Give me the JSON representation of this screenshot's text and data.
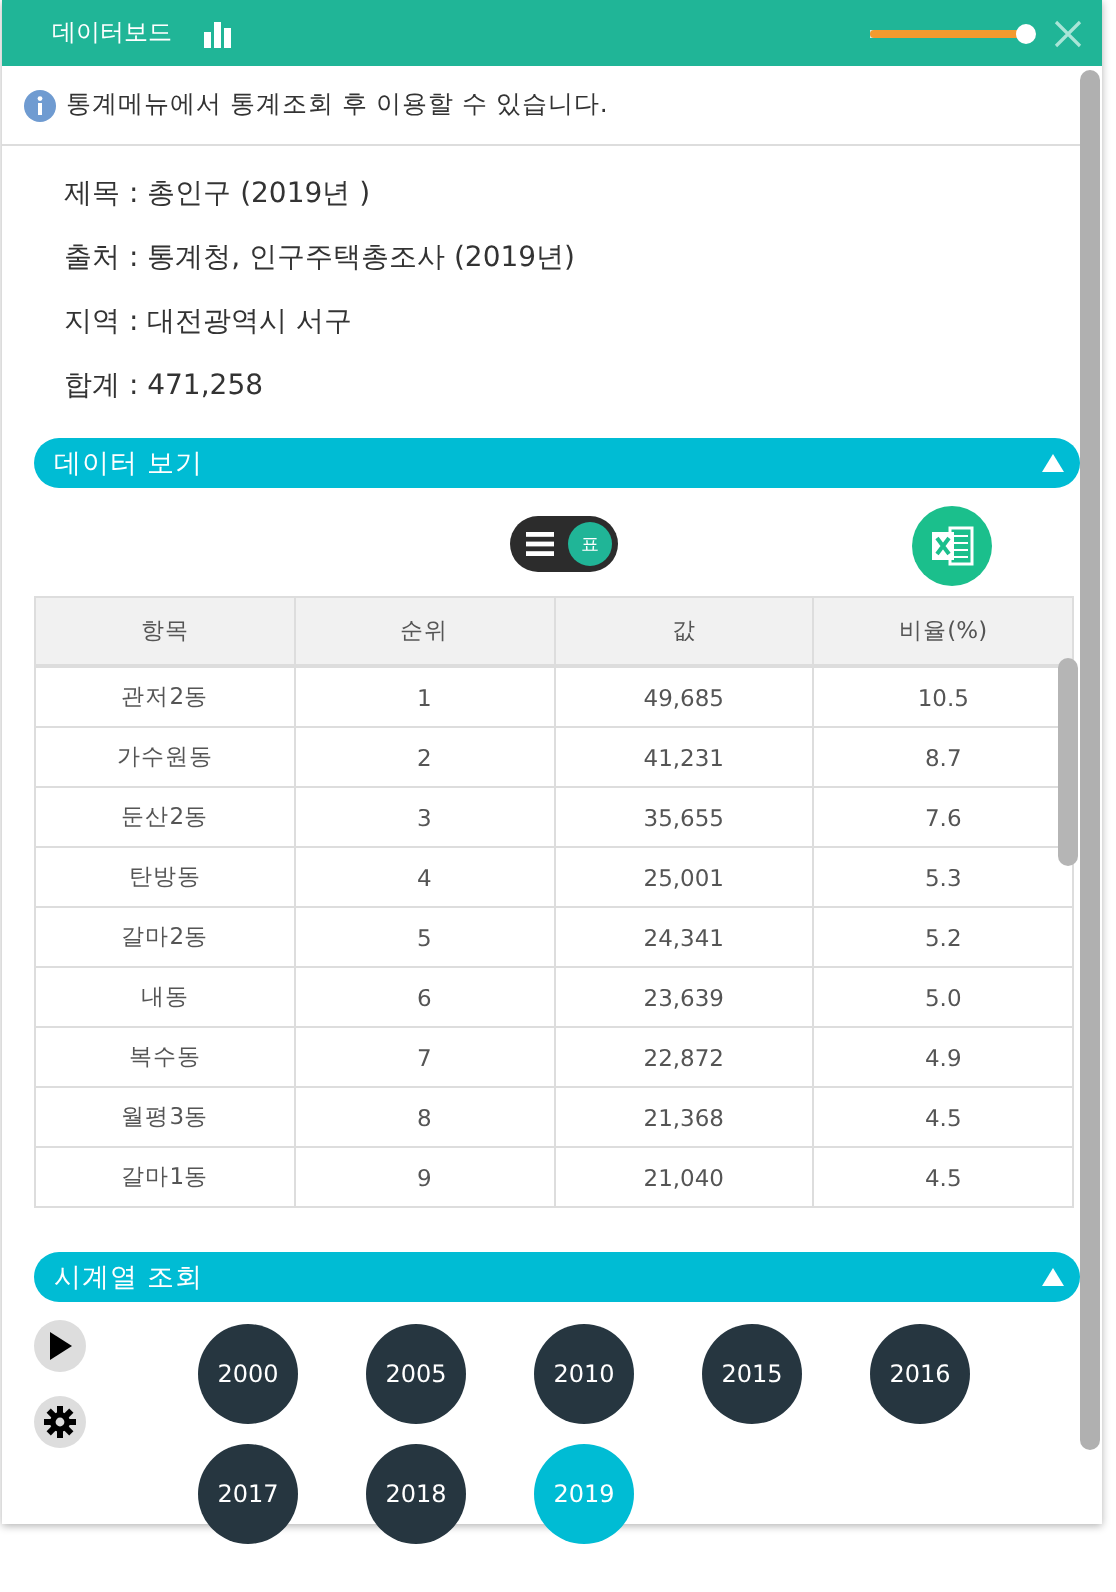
{
  "window": {
    "title": "데이터보드",
    "zoom_slider": {
      "level": 1
    }
  },
  "notice": "통계메뉴에서 통계조회 후 이용할 수 있습니다.",
  "info": [
    "제목 : 총인구 (2019년 )",
    "출처 : 통계청, 인구주택총조사 (2019년)",
    "지역 : 대전광역시 서구",
    "합계 : 471,258"
  ],
  "data_section": {
    "title": "데이터 보기",
    "expanded": true,
    "view_toggle": {
      "label": "표",
      "on": true
    },
    "table": {
      "columns": [
        "항목",
        "순위",
        "값",
        "비율(%)"
      ],
      "rows": [
        [
          "관저2동",
          "1",
          "49,685",
          "10.5"
        ],
        [
          "가수원동",
          "2",
          "41,231",
          "8.7"
        ],
        [
          "둔산2동",
          "3",
          "35,655",
          "7.6"
        ],
        [
          "탄방동",
          "4",
          "25,001",
          "5.3"
        ],
        [
          "갈마2동",
          "5",
          "24,341",
          "5.2"
        ],
        [
          "내동",
          "6",
          "23,639",
          "5.0"
        ],
        [
          "복수동",
          "7",
          "22,872",
          "4.9"
        ],
        [
          "월평3동",
          "8",
          "21,368",
          "4.5"
        ],
        [
          "갈마1동",
          "9",
          "21,040",
          "4.5"
        ]
      ]
    }
  },
  "timeseries_section": {
    "title": "시계열 조회",
    "expanded": true,
    "years": [
      {
        "label": "2000",
        "selected": false
      },
      {
        "label": "2005",
        "selected": false
      },
      {
        "label": "2010",
        "selected": false
      },
      {
        "label": "2015",
        "selected": false
      },
      {
        "label": "2016",
        "selected": false
      },
      {
        "label": "2017",
        "selected": false
      },
      {
        "label": "2018",
        "selected": false
      },
      {
        "label": "2019",
        "selected": true
      }
    ]
  }
}
